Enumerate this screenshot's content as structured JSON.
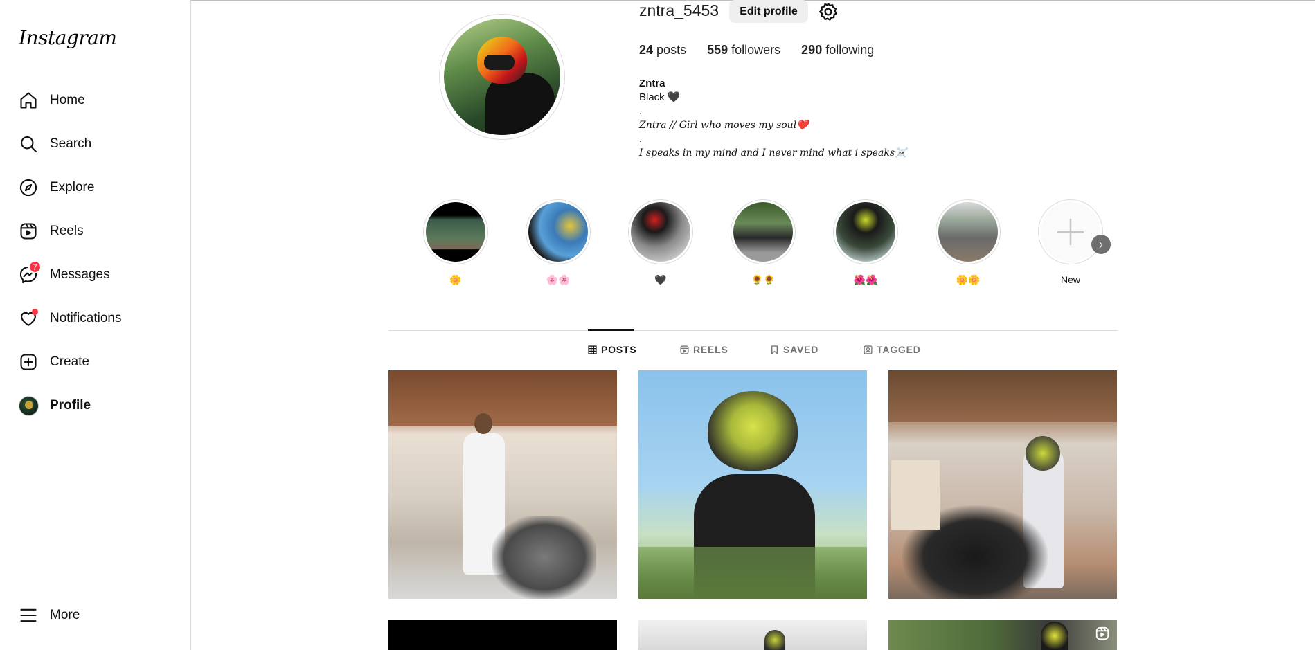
{
  "sidebar": {
    "logo": "Instagram",
    "items": [
      {
        "label": "Home",
        "icon": "home-icon"
      },
      {
        "label": "Search",
        "icon": "search-icon"
      },
      {
        "label": "Explore",
        "icon": "explore-icon"
      },
      {
        "label": "Reels",
        "icon": "reels-icon"
      },
      {
        "label": "Messages",
        "icon": "messages-icon",
        "badge": "7"
      },
      {
        "label": "Notifications",
        "icon": "heart-icon"
      },
      {
        "label": "Create",
        "icon": "create-icon"
      },
      {
        "label": "Profile",
        "icon": "avatar"
      }
    ],
    "more": "More"
  },
  "profile": {
    "username": "zntra_5453",
    "edit_label": "Edit profile",
    "posts_count": "24",
    "posts_label": "posts",
    "followers_count": "559",
    "followers_label": "followers",
    "following_count": "290",
    "following_label": "following",
    "name": "Zntra",
    "bio_line1": "Black 🖤",
    "bio_dot1": ".",
    "bio_line2": "Zntra // Girl who moves my soul❤️",
    "bio_dot2": ".",
    "bio_line3": "I speaks in my mind and I never mind what i speaks☠️"
  },
  "highlights": [
    {
      "label": "🌼"
    },
    {
      "label": "🌸🌸"
    },
    {
      "label": "🖤"
    },
    {
      "label": "🌻🌻"
    },
    {
      "label": "🌺🌺"
    },
    {
      "label": "🌼🌼"
    },
    {
      "label": "New"
    }
  ],
  "tabs": {
    "posts": "POSTS",
    "reels": "REELS",
    "saved": "SAVED",
    "tagged": "TAGGED"
  },
  "colors": {
    "badge": "#ff3040",
    "tab_active": "#111111",
    "tab_inactive": "#737373",
    "button_bg": "#efefef"
  }
}
